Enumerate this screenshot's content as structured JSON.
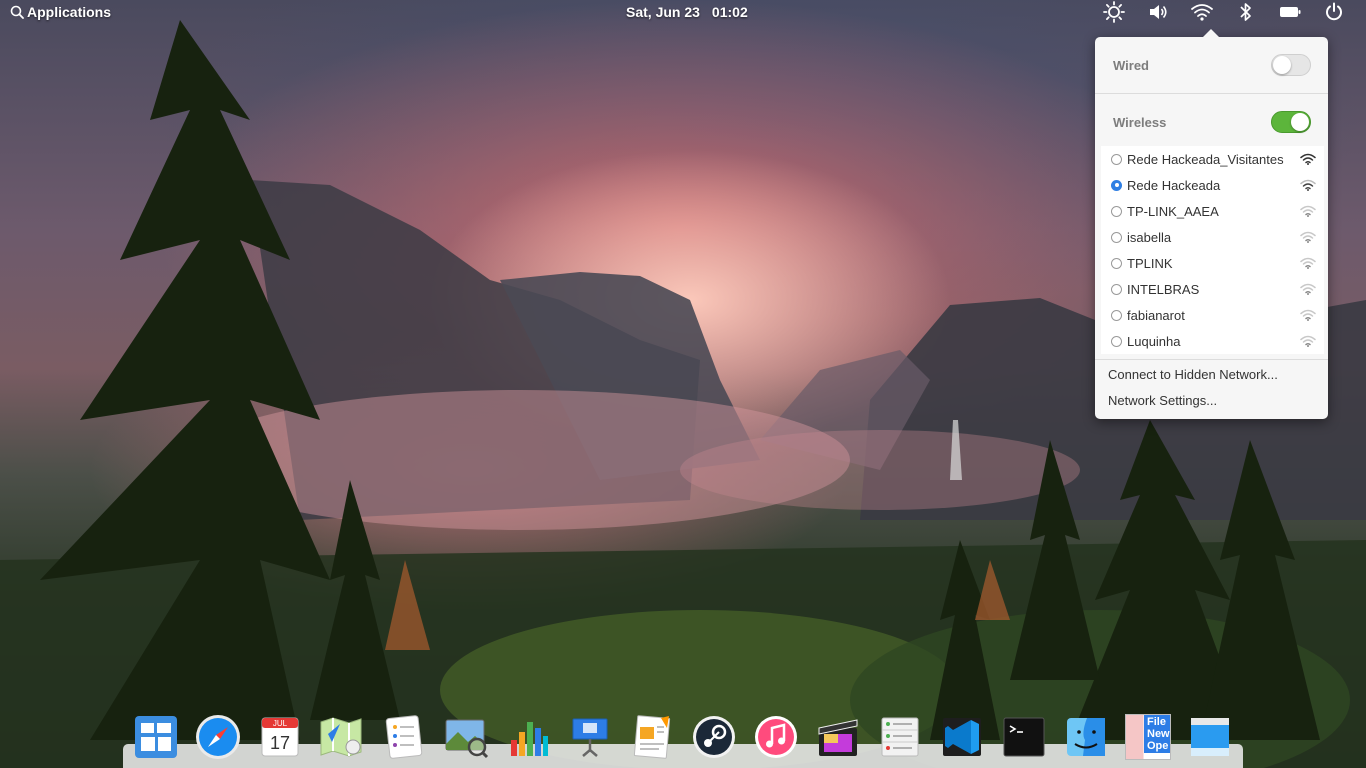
{
  "panel": {
    "applications_label": "Applications",
    "date": "Sat, Jun 23",
    "time": "01:02",
    "indicators": [
      {
        "icon": "brightness-icon"
      },
      {
        "icon": "volume-icon"
      },
      {
        "icon": "wifi-icon"
      },
      {
        "icon": "bluetooth-icon"
      },
      {
        "icon": "battery-icon"
      },
      {
        "icon": "power-icon"
      }
    ]
  },
  "network_popover": {
    "wired_label": "Wired",
    "wired_enabled": false,
    "wireless_label": "Wireless",
    "wireless_enabled": true,
    "networks": [
      {
        "name": "Rede Hackeada_Visitantes",
        "selected": false
      },
      {
        "name": "Rede Hackeada",
        "selected": true
      },
      {
        "name": "TP-LINK_AAEA",
        "selected": false
      },
      {
        "name": "isabella",
        "selected": false
      },
      {
        "name": "TPLINK",
        "selected": false
      },
      {
        "name": "INTELBRAS",
        "selected": false
      },
      {
        "name": "fabianarot",
        "selected": false
      },
      {
        "name": "Luquinha",
        "selected": false
      }
    ],
    "connect_hidden_label": "Connect to Hidden Network...",
    "network_settings_label": "Network Settings..."
  },
  "dock": {
    "apps": [
      {
        "name": "multitasking-view",
        "icon": "multitasking-icon"
      },
      {
        "name": "safari",
        "icon": "compass-icon"
      },
      {
        "name": "calendar",
        "icon": "calendar-icon",
        "month": "JUL",
        "day": "17"
      },
      {
        "name": "maps",
        "icon": "maps-icon"
      },
      {
        "name": "reminders",
        "icon": "reminders-icon"
      },
      {
        "name": "photos",
        "icon": "photo-viewer-icon"
      },
      {
        "name": "numbers",
        "icon": "chart-icon"
      },
      {
        "name": "keynote",
        "icon": "presentation-icon"
      },
      {
        "name": "pages",
        "icon": "document-icon"
      },
      {
        "name": "steam",
        "icon": "steam-icon"
      },
      {
        "name": "itunes",
        "icon": "music-note-icon"
      },
      {
        "name": "final-cut-pro",
        "icon": "clapperboard-icon"
      },
      {
        "name": "system-info",
        "icon": "settings-list-icon"
      },
      {
        "name": "visual-studio-code",
        "icon": "code-editor-icon"
      },
      {
        "name": "terminal",
        "icon": "terminal-icon"
      },
      {
        "name": "finder",
        "icon": "finder-icon"
      },
      {
        "name": "file-new",
        "icon": "file-new-icon",
        "text": "File New Ope"
      },
      {
        "name": "desktop",
        "icon": "window-icon"
      }
    ]
  }
}
